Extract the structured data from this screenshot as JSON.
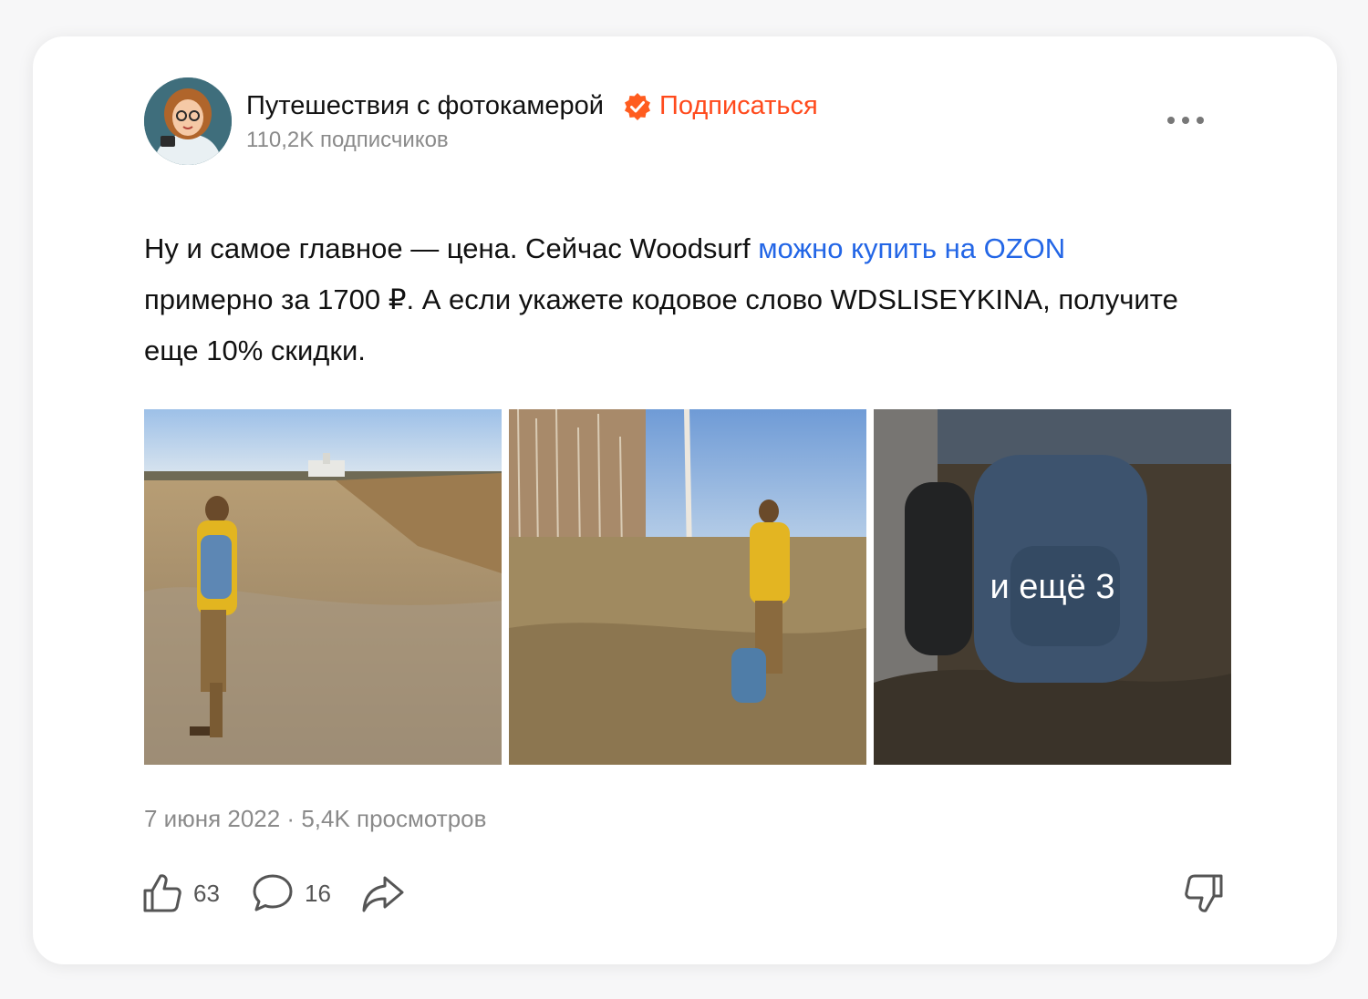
{
  "header": {
    "channel_name": "Путешествия с фотокамерой",
    "subscribe_label": "Подписаться",
    "subscribers": "110,2K подписчиков"
  },
  "post": {
    "text_before_link": "Ну и самое главное — цена. Сейчас Woodsurf ",
    "link_text": "можно купить на OZON",
    "text_after_link": " примерно за 1700 ₽. А если укажете кодовое слово WDSLISEYKINA, получите еще 10% скидки."
  },
  "gallery": {
    "more_label": "и ещё 3"
  },
  "meta": {
    "date_views": "7 июня 2022 · 5,4K просмотров"
  },
  "actions": {
    "likes": "63",
    "comments": "16"
  },
  "colors": {
    "accent": "#ff4a1c",
    "link": "#2366e6",
    "muted": "#8a8a8a"
  }
}
